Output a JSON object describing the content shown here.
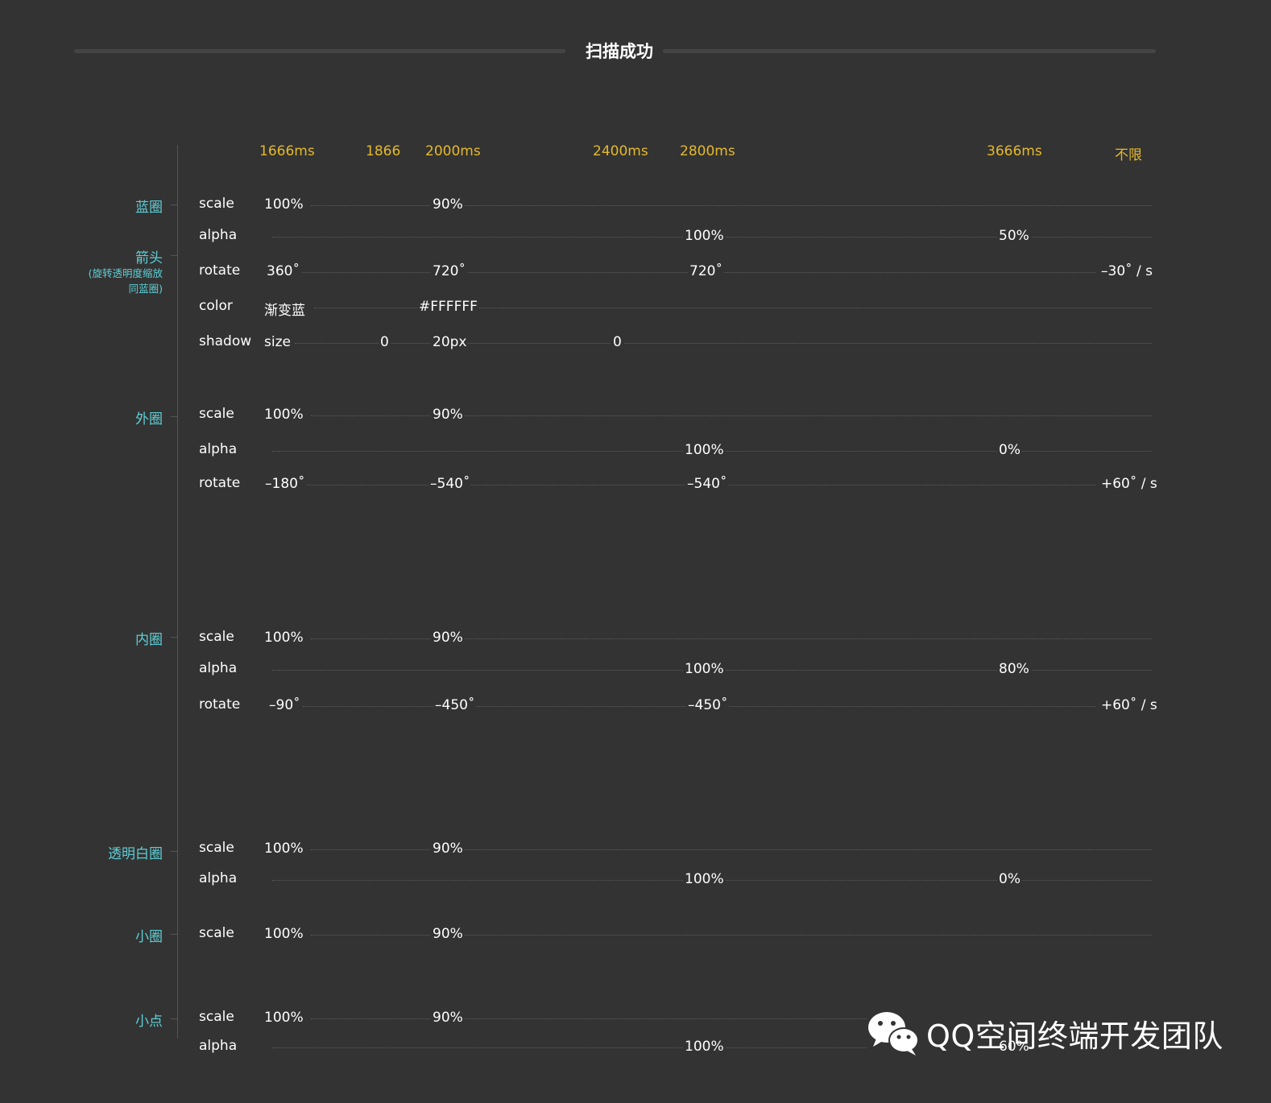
{
  "title": "扫描成功",
  "timeline": [
    "1666ms",
    "1866",
    "2000ms",
    "2400ms",
    "2800ms",
    "3666ms",
    "不限"
  ],
  "groups": [
    {
      "name": "蓝圈"
    },
    {
      "name": "箭头",
      "sub": [
        "(旋转透明度缩放",
        "同蓝圈)"
      ]
    },
    {
      "name": "外圈"
    },
    {
      "name": "内圈"
    },
    {
      "name": "透明白圈"
    },
    {
      "name": "小圈"
    },
    {
      "name": "小点"
    }
  ],
  "rows": [
    {
      "prop": "scale",
      "values": [
        "100%",
        "90%"
      ]
    },
    {
      "prop": "alpha",
      "values": [
        "100%",
        "50%"
      ]
    },
    {
      "prop": "rotate",
      "values": [
        "360˚",
        "720˚",
        "720˚",
        "–30˚ / s"
      ]
    },
    {
      "prop": "color",
      "values": [
        "渐变蓝",
        "#FFFFFF"
      ]
    },
    {
      "prop": "shadow",
      "sub": "size",
      "values": [
        "0",
        "20px",
        "0"
      ]
    },
    {
      "prop": "scale",
      "values": [
        "100%",
        "90%"
      ]
    },
    {
      "prop": "alpha",
      "values": [
        "100%",
        "0%"
      ]
    },
    {
      "prop": "rotate",
      "values": [
        "–180˚",
        "–540˚",
        "–540˚",
        "+60˚ / s"
      ]
    },
    {
      "prop": "scale",
      "values": [
        "100%",
        "90%"
      ]
    },
    {
      "prop": "alpha",
      "values": [
        "100%",
        "80%"
      ]
    },
    {
      "prop": "rotate",
      "values": [
        "–90˚",
        "–450˚",
        "–450˚",
        "+60˚ / s"
      ]
    },
    {
      "prop": "scale",
      "values": [
        "100%",
        "90%"
      ]
    },
    {
      "prop": "alpha",
      "values": [
        "100%",
        "0%"
      ]
    },
    {
      "prop": "scale",
      "values": [
        "100%",
        "90%"
      ]
    },
    {
      "prop": "scale",
      "values": [
        "100%",
        "90%"
      ]
    },
    {
      "prop": "alpha",
      "values": [
        "100%",
        "60%"
      ]
    }
  ],
  "watermark": {
    "icon": "wechat-icon",
    "text": "QQ空间终端开发团队"
  },
  "colors": {
    "background": "#333333",
    "time": "#e5b92c",
    "group": "#5ecfd6",
    "text": "#ffffff"
  }
}
